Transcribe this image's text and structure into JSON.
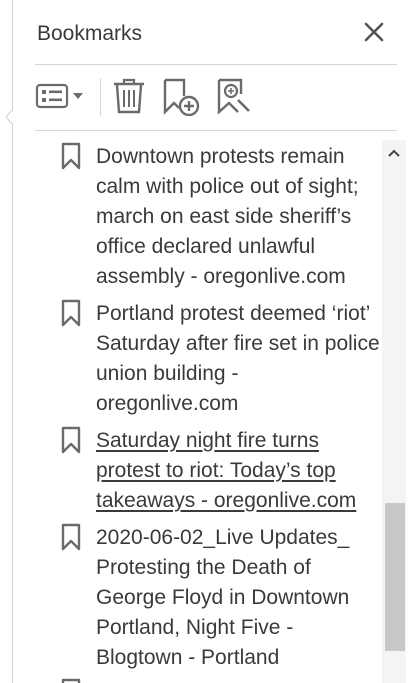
{
  "panel": {
    "title": "Bookmarks"
  },
  "icons": {
    "close": "close-icon",
    "options": "options-menu-icon",
    "delete": "trash-icon",
    "add": "add-bookmark-icon",
    "new_from_structure": "bookmark-search-icon",
    "bookmark": "bookmark-icon",
    "scroll_up": "chevron-up-icon"
  },
  "bookmarks": [
    {
      "label": "Downtown protests remain calm with police out of sight; march on east side sheriff’s office declared unlawful assembly - oregonlive.com"
    },
    {
      "label": "Portland protest deemed ‘riot’ Saturday after fire set in police union building - oregonlive.com"
    },
    {
      "label": "Saturday night fire turns protest to riot: Today’s top takeaways - oregonlive.com"
    },
    {
      "label": "2020-06-02_Live Updates_ Protesting the Death of George Floyd in Downtown Portland, Night Five - Blogtown - Portland"
    }
  ],
  "colors": {
    "text": "#3a3a3a",
    "icon": "#6b6b6b",
    "divider": "#d6d6d6",
    "scroll_track": "#f4f4f4",
    "scroll_thumb": "#c8c8c8"
  }
}
